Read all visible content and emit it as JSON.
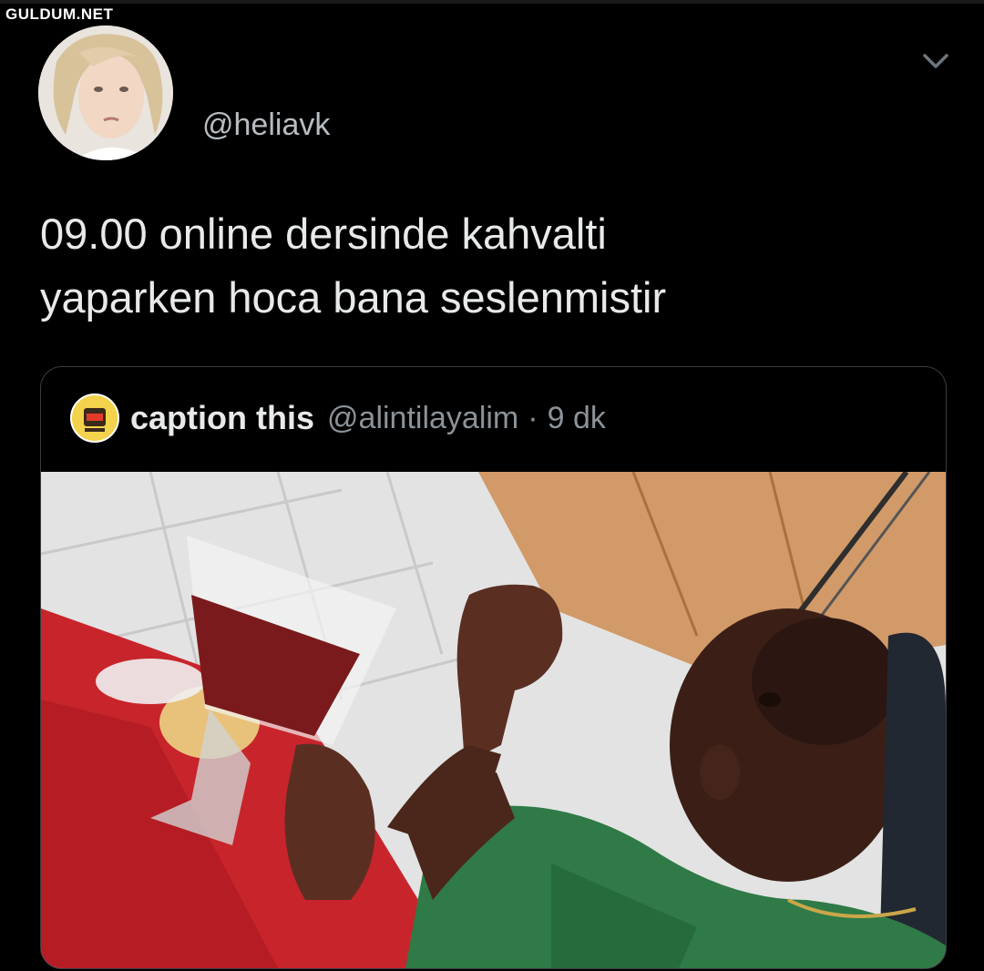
{
  "watermark": "GULDUM.NET",
  "tweet": {
    "handle": "@heliavk",
    "text_line1": "09.00 online dersinde kahvalti",
    "text_line2": "yaparken hoca bana seslenmistir",
    "menu_icon": "chevron-down-icon"
  },
  "quoted": {
    "name": "caption this",
    "handle": "@alintilayalim",
    "separator": "·",
    "time": "9 dk"
  },
  "colors": {
    "background": "#000000",
    "text_primary": "#e7e9ea",
    "text_secondary": "#8b9298",
    "border": "#3a3d40"
  }
}
